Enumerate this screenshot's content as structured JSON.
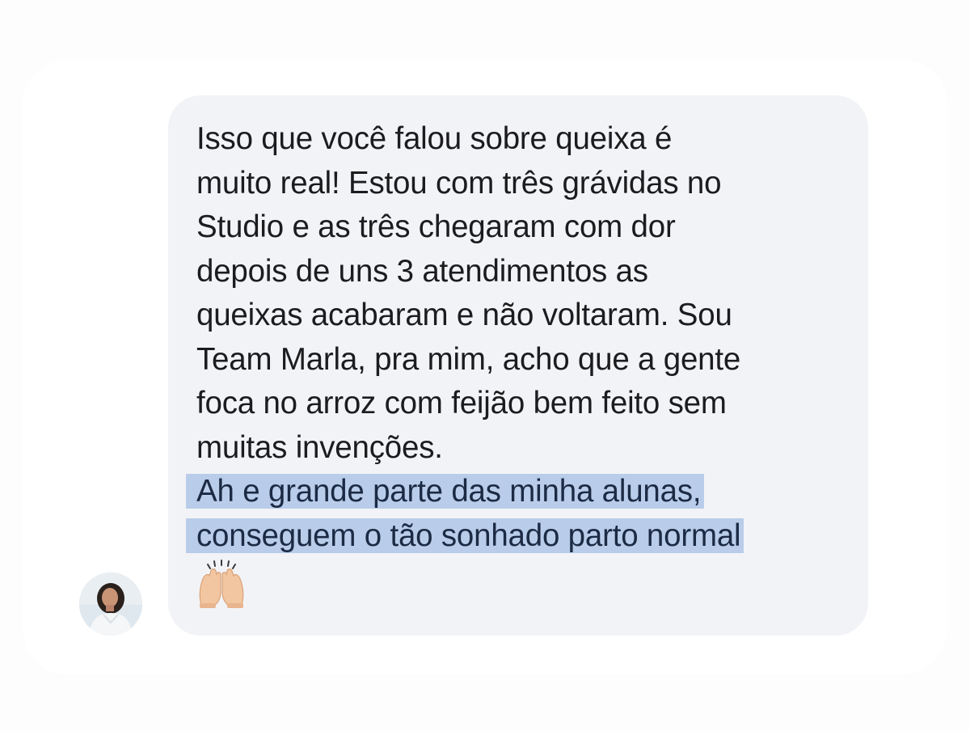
{
  "message": {
    "lines": [
      "Isso que você falou sobre queixa é",
      "muito real! Estou com três grávidas no",
      "Studio e as três chegaram com dor",
      "depois de uns 3 atendimentos as",
      "queixas acabaram e não voltaram. Sou",
      "Team Marla, pra mim, acho que a gente",
      "foca no arroz com feijão bem feito sem",
      "muitas invenções."
    ],
    "highlighted_lines": [
      "Ah e grande parte das minha alunas,",
      "conseguem o tão sonhado parto normal"
    ],
    "emoji": "raising-hands-icon"
  },
  "avatar": {
    "icon": "user-avatar-photo"
  },
  "colors": {
    "bubble": "#f2f3f6",
    "highlight": "#b9cdea",
    "text": "#1c1c1e"
  }
}
